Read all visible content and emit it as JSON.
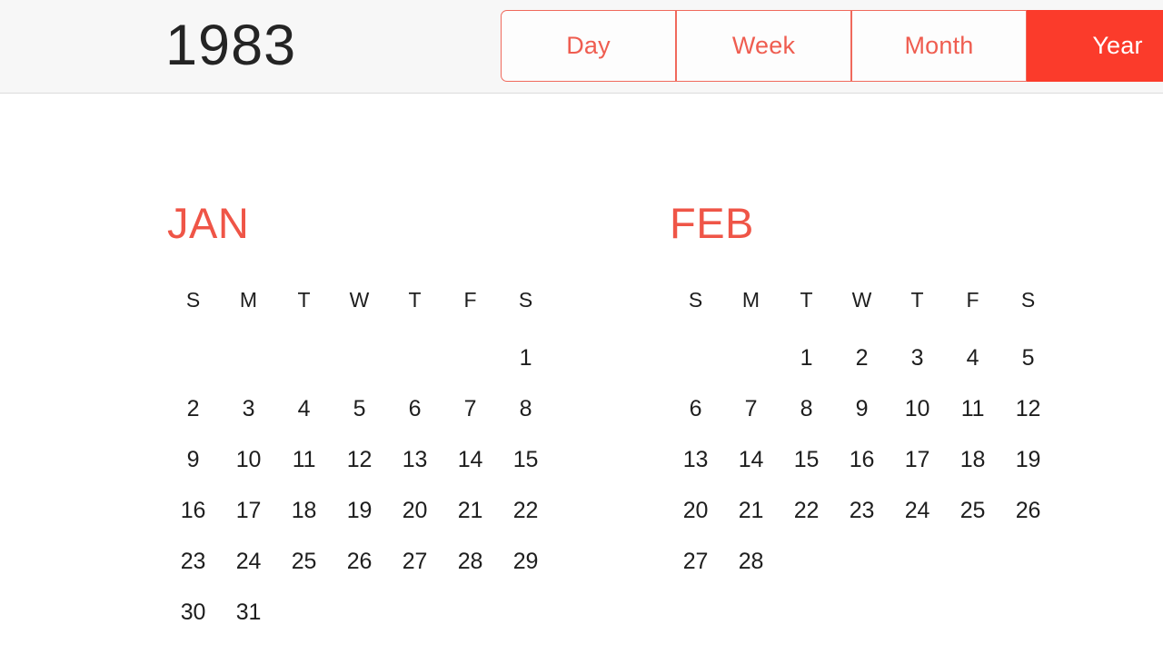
{
  "toolbar": {
    "year_title": "1983",
    "view_segments": [
      {
        "label": "Day",
        "selected": false
      },
      {
        "label": "Week",
        "selected": false
      },
      {
        "label": "Month",
        "selected": false
      },
      {
        "label": "Year",
        "selected": true
      }
    ],
    "accent_color": "#ef5d50",
    "selected_color": "#fb3b2b",
    "background_color": "#f7f7f7"
  },
  "calendar": {
    "year": "1983",
    "view": "Year",
    "weekday_headers": [
      "S",
      "M",
      "T",
      "W",
      "T",
      "F",
      "S"
    ],
    "month_label_color": "#ef5547",
    "months": [
      {
        "name": "JAN",
        "first_day_column": 6,
        "num_days": 31,
        "weeks": [
          [
            "",
            "",
            "",
            "",
            "",
            "",
            "1"
          ],
          [
            "2",
            "3",
            "4",
            "5",
            "6",
            "7",
            "8"
          ],
          [
            "9",
            "10",
            "11",
            "12",
            "13",
            "14",
            "15"
          ],
          [
            "16",
            "17",
            "18",
            "19",
            "20",
            "21",
            "22"
          ],
          [
            "23",
            "24",
            "25",
            "26",
            "27",
            "28",
            "29"
          ],
          [
            "30",
            "31",
            "",
            "",
            "",
            "",
            ""
          ]
        ]
      },
      {
        "name": "FEB",
        "first_day_column": 2,
        "num_days": 28,
        "weeks": [
          [
            "",
            "",
            "1",
            "2",
            "3",
            "4",
            "5"
          ],
          [
            "6",
            "7",
            "8",
            "9",
            "10",
            "11",
            "12"
          ],
          [
            "13",
            "14",
            "15",
            "16",
            "17",
            "18",
            "19"
          ],
          [
            "20",
            "21",
            "22",
            "23",
            "24",
            "25",
            "26"
          ],
          [
            "27",
            "28",
            "",
            "",
            "",
            "",
            ""
          ]
        ]
      }
    ]
  }
}
